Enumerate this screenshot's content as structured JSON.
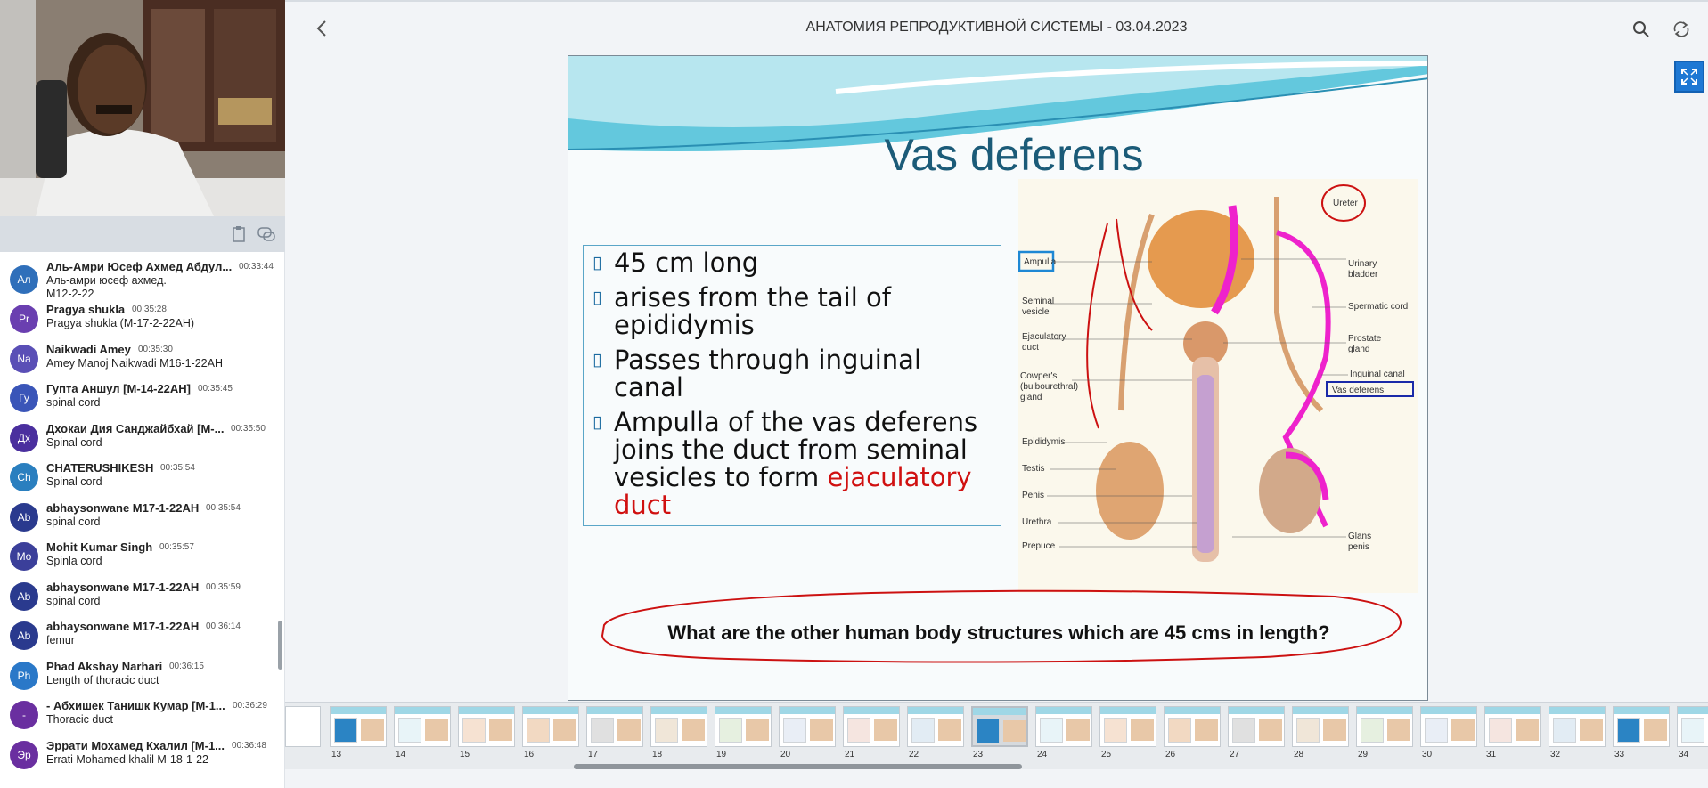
{
  "header": {
    "title": "АНАТОМИЯ РЕПРОДУКТИВНОЙ СИСТЕМЫ - 03.04.2023"
  },
  "icons": {
    "back": "chevron-left-icon",
    "search": "search-icon",
    "sync": "sync-icon",
    "fullscreen": "expand-icon",
    "copy": "clipboard-icon",
    "chat": "chat-icon"
  },
  "colors": {
    "accent": "#1e78d4",
    "slide_title": "#1b5b78",
    "highlight": "#d01010",
    "annotation": "#cc1111"
  },
  "chat": [
    {
      "initials": "Ал",
      "color": "#2f6fba",
      "name": "Аль-Амри Юсеф Ахмед Абдул...",
      "time": "00:33:44",
      "text": "Аль-амри юсеф ахмед.",
      "text2": "M12-2-22"
    },
    {
      "initials": "Pr",
      "color": "#6a3fb0",
      "name": "Pragya shukla",
      "time": "00:35:28",
      "text": "Pragya shukla (M-17-2-22AH)"
    },
    {
      "initials": "Na",
      "color": "#5a4fb6",
      "name": "Naikwadi Amey",
      "time": "00:35:30",
      "text": "Amey Manoj Naikwadi M16-1-22AH"
    },
    {
      "initials": "Гу",
      "color": "#3a55b8",
      "name": "Гупта Аншул [М-14-22АН]",
      "time": "00:35:45",
      "text": "spinal cord"
    },
    {
      "initials": "Дх",
      "color": "#4a2f9e",
      "name": "Дхокаи Дия Санджайбхай [М-...",
      "time": "00:35:50",
      "text": "Spinal cord"
    },
    {
      "initials": "Ch",
      "color": "#2a7fbf",
      "name": "CHATERUSHIKESH",
      "time": "00:35:54",
      "text": "Spinal cord"
    },
    {
      "initials": "Ab",
      "color": "#2a3a8e",
      "name": "abhaysonwane M17-1-22AH",
      "time": "00:35:54",
      "text": "spinal cord"
    },
    {
      "initials": "Mo",
      "color": "#3b3f9a",
      "name": "Mohit Kumar Singh",
      "time": "00:35:57",
      "text": "Spinla cord"
    },
    {
      "initials": "Ab",
      "color": "#2a3a8e",
      "name": "abhaysonwane M17-1-22AH",
      "time": "00:35:59",
      "text": "spinal cord"
    },
    {
      "initials": "Ab",
      "color": "#2a3a8e",
      "name": "abhaysonwane M17-1-22AH",
      "time": "00:36:14",
      "text": "femur"
    },
    {
      "initials": "Ph",
      "color": "#2a78c8",
      "name": "Phad Akshay Narhari",
      "time": "00:36:15",
      "text": "Length of thoracic duct"
    },
    {
      "initials": "-",
      "color": "#6a2fa0",
      "name": "- Абхишек Танишк Кумар [М-1...",
      "time": "00:36:29",
      "text": "Thoracic duct"
    },
    {
      "initials": "Эр",
      "color": "#6a2fa0",
      "name": "Эррати Мохамед Кхалил [М-1...",
      "time": "00:36:48",
      "text": "Errati Mohamed khalil M-18-1-22"
    }
  ],
  "slide": {
    "title": "Vas deferens",
    "bullets": [
      {
        "text": "45 cm long"
      },
      {
        "text": "arises from the tail of epididymis"
      },
      {
        "text": "Passes through inguinal canal"
      },
      {
        "text": "Ampulla of the vas deferens joins the duct from seminal vesicles to form ",
        "highlight": "ejaculatory duct"
      }
    ],
    "diagram_labels": {
      "ampulla": "Ampulla",
      "seminal": "Seminal",
      "vesicle": "vesicle",
      "ejac1": "Ejaculatory",
      "ejac2": "duct",
      "cowper1": "Cowper's",
      "cowper2": "(bulbourethral)",
      "cowper3": "gland",
      "epididymis": "Epididymis",
      "testis": "Testis",
      "penis": "Penis",
      "urethra": "Urethra",
      "prepuce": "Prepuce",
      "ureter": "Ureter",
      "urinary1": "Urinary",
      "urinary2": "bladder",
      "spermatic": "Spermatic cord",
      "prostate1": "Prostate",
      "prostate2": "gland",
      "inguinal": "Inguinal canal",
      "vas": "Vas deferens",
      "glans1": "Glans",
      "glans2": "penis"
    },
    "question": "What are the other human body structures which are 45 cms in length?"
  },
  "thumbnails": [
    "13",
    "14",
    "15",
    "16",
    "17",
    "18",
    "19",
    "20",
    "21",
    "22",
    "23",
    "24",
    "25",
    "26",
    "27",
    "28",
    "29",
    "30",
    "31",
    "32",
    "33",
    "34"
  ],
  "current_slide": "23"
}
